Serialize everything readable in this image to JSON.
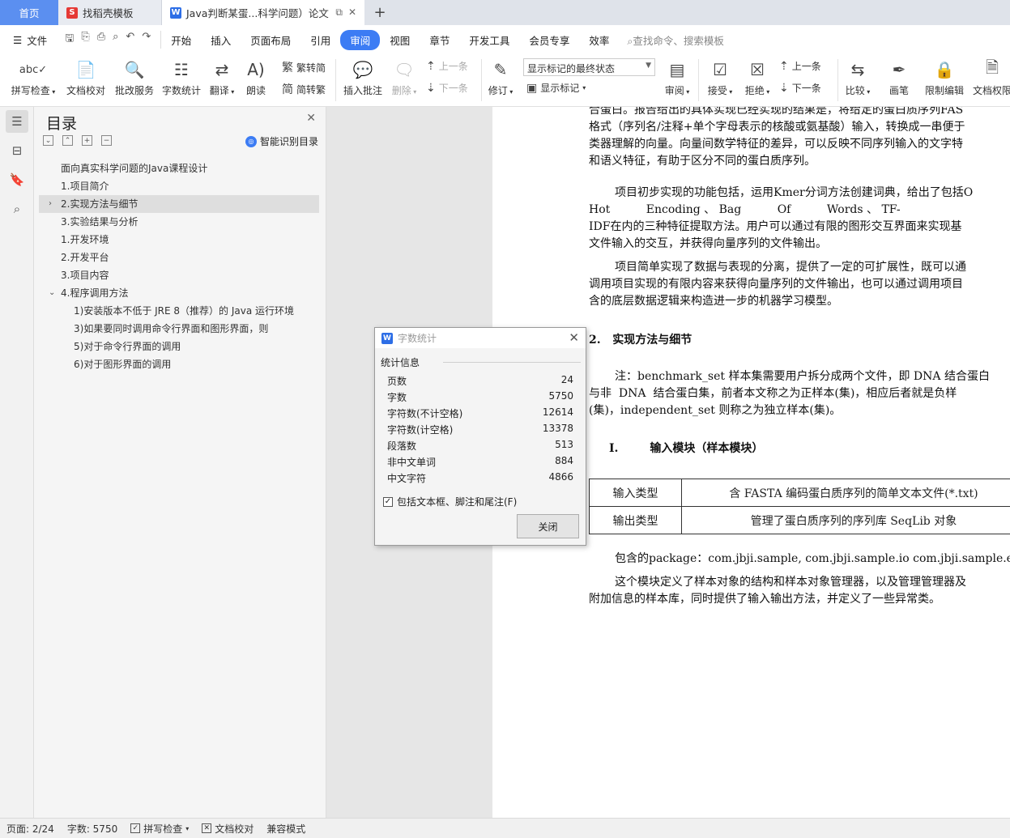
{
  "tabs": {
    "home": "首页",
    "template": "找稻壳模板",
    "doc": "Java判断某蛋...科学问题）论文"
  },
  "menubar": {
    "file": "文件",
    "items": [
      "开始",
      "插入",
      "页面布局",
      "引用",
      "审阅",
      "视图",
      "章节",
      "开发工具",
      "会员专享",
      "效率"
    ],
    "active": "审阅",
    "search": "查找命令、搜索模板"
  },
  "ribbon": {
    "spell": "拼写检查",
    "proof": "文档校对",
    "batch": "批改服务",
    "wordcount": "字数统计",
    "translate": "翻译",
    "read": "朗读",
    "trad2simp": "繁转简",
    "simp2trad": "简转繁",
    "insert_comment": "插入批注",
    "delete": "删除",
    "prev": "上一条",
    "next": "下一条",
    "revise": "修订",
    "markup_select": "显示标记的最终状态",
    "show_markup": "显示标记",
    "review": "审阅",
    "accept": "接受",
    "reject": "拒绝",
    "prev2": "上一条",
    "next2": "下一条",
    "compare": "比较",
    "pen": "画笔",
    "restrict": "限制编辑",
    "doc_perm": "文档权限"
  },
  "toc": {
    "title": "目录",
    "smart": "智能识别目录",
    "items": [
      "面向真实科学问题的Java课程设计",
      "1.项目简介",
      "2.实现方法与细节",
      "3.实验结果与分析",
      "1.开发环境",
      "2.开发平台",
      "3.项目内容",
      "4.程序调用方法",
      "1)安装版本不低于 JRE 8（推荐）的 Java 运行环境",
      "3)如果要同时调用命令行界面和图形界面，则",
      "5)对于命令行界面的调用",
      "6)对于图形界面的调用"
    ]
  },
  "document": {
    "p1": [
      "合蛋白。报告给出的具体实现已经实现的结果是，将给定的蛋白质序列FAS",
      "格式（序列名/注释+单个字母表示的核酸或氨基酸）输入，转换成一串便于",
      "类器理解的向量。向量间数学特征的差异，可以反映不同序列输入的文字特",
      "和语义特征，有助于区分不同的蛋白质序列。"
    ],
    "p2": [
      "项目初步实现的功能包括，运用Kmer分词方法创建词典，给出了包括O",
      "Hot          Encoding 、 Bag          Of          Words 、 TF-",
      "IDF在内的三种特征提取方法。用户可以通过有限的图形交互界面来实现基",
      "文件输入的交互，并获得向量序列的文件输出。"
    ],
    "p3": [
      "项目简单实现了数据与表现的分离，提供了一定的可扩展性，既可以通",
      "调用项目实现的有限内容来获得向量序列的文件输出，也可以通过调用项目",
      "含的底层数据逻辑来构造进一步的机器学习模型。"
    ],
    "h2": "2.   实现方法与细节",
    "p4": [
      "注：benchmark_set 样本集需要用户拆分成两个文件，即 DNA 结合蛋白",
      "与非  DNA  结合蛋白集，前者本文称之为正样本(集)，相应后者就是负样",
      "(集)，independent_set 则称之为独立样本(集)。"
    ],
    "h3": "I.        输入模块（样本模块）",
    "table": [
      [
        "输入类型",
        "含 FASTA 编码蛋白质序列的简单文本文件(*.txt)"
      ],
      [
        "输出类型",
        "管理了蛋白质序列的序列库 SeqLib 对象"
      ]
    ],
    "p5": [
      "包含的package：com.jbji.sample, com.jbji.sample.io com.jbji.sample.excep"
    ],
    "p6": [
      "这个模块定义了样本对象的结构和样本对象管理器，以及管理管理器及",
      "附加信息的样本库，同时提供了输入输出方法，并定义了一些异常类。"
    ]
  },
  "dialog": {
    "title": "字数统计",
    "group": "统计信息",
    "rows": [
      {
        "label": "页数",
        "value": "24"
      },
      {
        "label": "字数",
        "value": "5750"
      },
      {
        "label": "字符数(不计空格)",
        "value": "12614"
      },
      {
        "label": "字符数(计空格)",
        "value": "13378"
      },
      {
        "label": "段落数",
        "value": "513"
      },
      {
        "label": "非中文单词",
        "value": "884"
      },
      {
        "label": "中文字符",
        "value": "4866"
      }
    ],
    "checkbox": "包括文本框、脚注和尾注(F)",
    "close": "关闭"
  },
  "status": {
    "page": "页面: 2/24",
    "words": "字数: 5750",
    "spell": "拼写检查",
    "proof": "文档校对",
    "compat": "兼容模式"
  }
}
